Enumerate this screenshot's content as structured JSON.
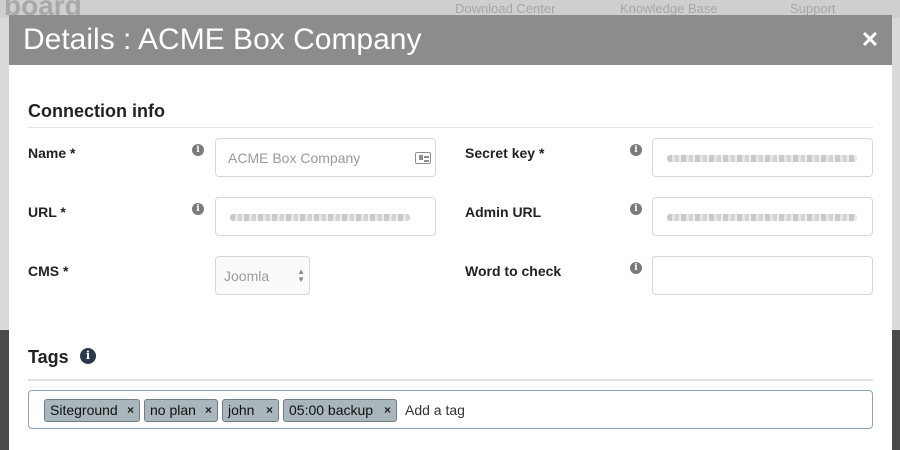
{
  "background": {
    "logo_fragment": "board",
    "nav": [
      "Download Center",
      "Knowledge Base",
      "Support"
    ]
  },
  "modal": {
    "title": "Details : ACME Box Company",
    "close_icon": "close-icon"
  },
  "connection": {
    "section_title": "Connection info",
    "name": {
      "label": "Name *",
      "value": "ACME Box Company"
    },
    "url": {
      "label": "URL *",
      "value": ""
    },
    "cms": {
      "label": "CMS *",
      "selected": "Joomla"
    },
    "secret_key": {
      "label": "Secret key *",
      "value": ""
    },
    "admin_url": {
      "label": "Admin URL",
      "value": ""
    },
    "word_to_check": {
      "label": "Word to check",
      "value": ""
    }
  },
  "tags": {
    "section_title": "Tags",
    "items": [
      "Siteground",
      "no plan",
      "john",
      "05:00 backup"
    ],
    "remove_glyph": "×",
    "add_placeholder": "Add a tag"
  },
  "colors": {
    "header": "#8c8c8c",
    "tag_bg": "#a9b7bd"
  }
}
